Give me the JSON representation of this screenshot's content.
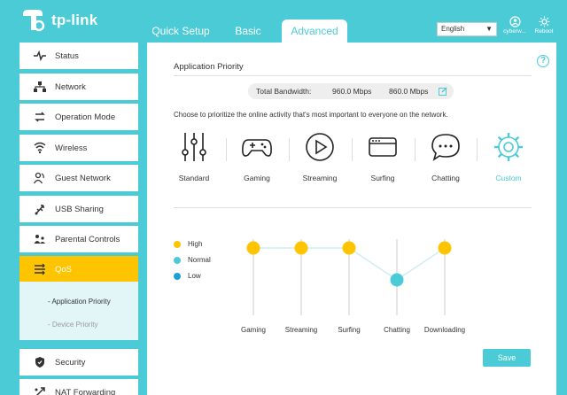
{
  "header": {
    "brand": "tp-link",
    "tabs": {
      "quick_setup": "Quick Setup",
      "basic": "Basic",
      "advanced": "Advanced"
    },
    "language": "English",
    "user_label": "cyberw...",
    "reboot_label": "Reboot"
  },
  "sidebar": {
    "items": [
      {
        "label": "Status",
        "icon": "pulse-icon"
      },
      {
        "label": "Network",
        "icon": "network-icon"
      },
      {
        "label": "Operation Mode",
        "icon": "operation-mode-icon"
      },
      {
        "label": "Wireless",
        "icon": "wifi-icon"
      },
      {
        "label": "Guest Network",
        "icon": "guest-icon"
      },
      {
        "label": "USB Sharing",
        "icon": "usb-icon"
      },
      {
        "label": "Parental Controls",
        "icon": "parental-icon"
      },
      {
        "label": "QoS",
        "icon": "qos-icon"
      },
      {
        "label": "Security",
        "icon": "shield-icon"
      },
      {
        "label": "NAT Forwarding",
        "icon": "nat-icon"
      }
    ],
    "sub_items": {
      "application_priority": "- Application Priority",
      "device_priority": "- Device Priority"
    }
  },
  "main": {
    "section_title": "Application Priority",
    "bandwidth_label": "Total Bandwidth:",
    "upload": "960.0 Mbps",
    "download": "860.0 Mbps",
    "description": "Choose to prioritize the online activity that's most important to everyone on the network.",
    "modes": [
      "Standard",
      "Gaming",
      "Streaming",
      "Surfing",
      "Chatting",
      "Custom"
    ],
    "selected_mode": "Custom",
    "legend": [
      "High",
      "Normal",
      "Low"
    ],
    "save_label": "Save"
  },
  "colors": {
    "accent": "#4ACBD6",
    "high": "#FFC400",
    "normal": "#4ACBD6",
    "low": "#1E9FD8"
  },
  "chart_data": {
    "type": "line",
    "categories": [
      "Gaming",
      "Streaming",
      "Surfing",
      "Chatting",
      "Downloading"
    ],
    "levels": [
      "High",
      "High",
      "High",
      "Normal",
      "High"
    ]
  }
}
